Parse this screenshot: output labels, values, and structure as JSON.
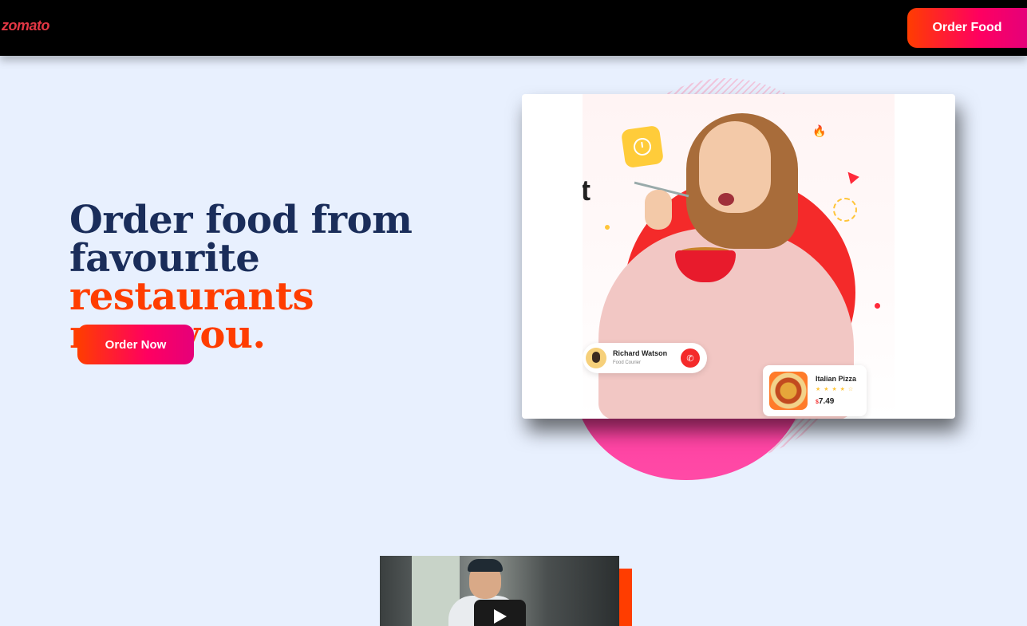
{
  "header": {
    "logo_text": "zomato",
    "order_food_label": "Order Food"
  },
  "hero": {
    "headline_line1": "Order food from",
    "headline_line2_plain": "favourite ",
    "headline_line2_accent": "restaurants",
    "headline_line3_accent": "near you.",
    "order_now_label": "Order Now",
    "illustration": {
      "side_letter": "t",
      "courier": {
        "name": "Richard Watson",
        "role": "Food Courier"
      },
      "pizza": {
        "name": "Italian Pizza",
        "stars": "★ ★ ★ ★ ☆",
        "currency": "$",
        "price": "7.49"
      }
    }
  },
  "colors": {
    "accent": "#ff3d00",
    "brand_gradient_end": "#ff0060",
    "headline_navy": "#1a2d5a",
    "page_bg": "#e8f0fe",
    "logo_red": "#e23744"
  },
  "icons": [
    "clock-icon",
    "flame-icon",
    "phone-icon",
    "play-icon"
  ]
}
